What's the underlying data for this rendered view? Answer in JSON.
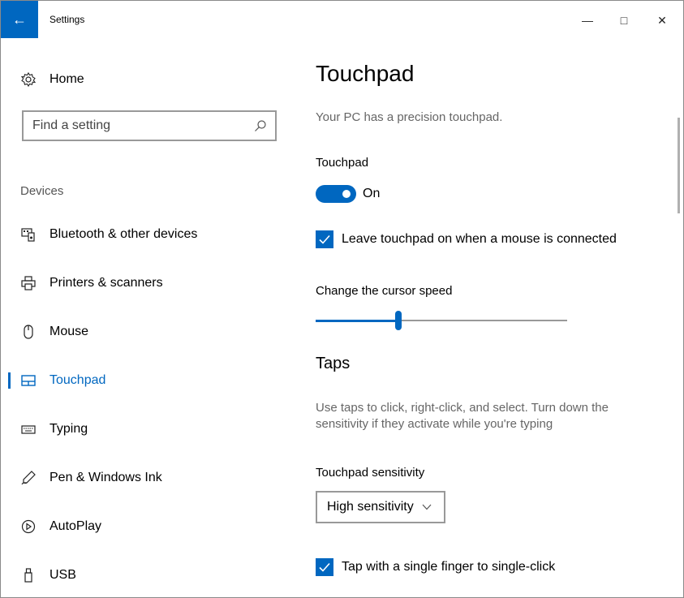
{
  "window": {
    "title": "Settings",
    "back_glyph": "←",
    "minimize_glyph": "—",
    "maximize_glyph": "□",
    "close_glyph": "✕"
  },
  "sidebar": {
    "home_label": "Home",
    "search": {
      "placeholder": "Find a setting"
    },
    "group_label": "Devices",
    "items": [
      {
        "label": "Bluetooth & other devices",
        "icon": "bluetooth-devices-icon"
      },
      {
        "label": "Printers & scanners",
        "icon": "printer-icon"
      },
      {
        "label": "Mouse",
        "icon": "mouse-icon"
      },
      {
        "label": "Touchpad",
        "icon": "touchpad-icon",
        "active": true
      },
      {
        "label": "Typing",
        "icon": "keyboard-icon"
      },
      {
        "label": "Pen & Windows Ink",
        "icon": "pen-icon"
      },
      {
        "label": "AutoPlay",
        "icon": "autoplay-icon"
      },
      {
        "label": "USB",
        "icon": "usb-icon"
      }
    ]
  },
  "main": {
    "title": "Touchpad",
    "subtitle": "Your PC has a precision touchpad.",
    "touchpad_toggle": {
      "label": "Touchpad",
      "state_text": "On",
      "on": true
    },
    "leave_on_checkbox": {
      "label": "Leave touchpad on when a mouse is connected",
      "checked": true
    },
    "cursor_speed": {
      "label": "Change the cursor speed",
      "value_fraction": 0.33
    },
    "taps": {
      "heading": "Taps",
      "description": "Use taps to click, right-click, and select. Turn down the sensitivity if they activate while you're typing",
      "sensitivity_label": "Touchpad sensitivity",
      "sensitivity_value": "High sensitivity",
      "single_tap_checkbox": {
        "label": "Tap with a single finger to single-click",
        "checked": true
      }
    }
  },
  "colors": {
    "accent": "#0067c0",
    "muted_text": "#666666",
    "border": "#999999"
  }
}
